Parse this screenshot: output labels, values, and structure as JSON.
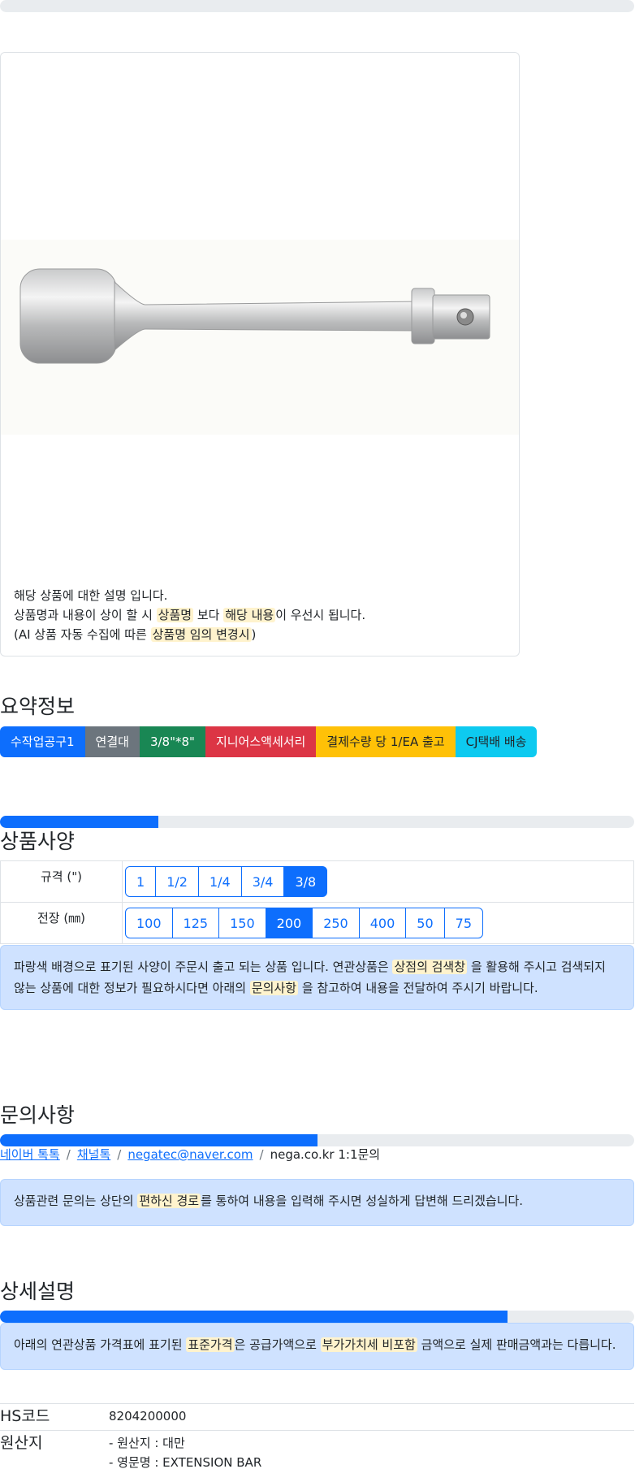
{
  "product": {
    "desc_line1": "해당 상품에 대한 설명 입니다.",
    "desc_line2_a": "상품명과 내용이 상이 할 시",
    "desc_line2_mark1": "상품명",
    "desc_line2_b": "보다",
    "desc_line2_mark2": "해당 내용",
    "desc_line2_c": "이 우선시 됩니다.",
    "desc_line3_a": "(AI 상품 자동 수집에 따른",
    "desc_line3_mark": "상품명 임의 변경시",
    "desc_line3_b": ")"
  },
  "summary": {
    "title": "요약정보",
    "badges": [
      {
        "label": "수작업공구1",
        "color": "#0d6efd"
      },
      {
        "label": "연결대",
        "color": "#6c757d"
      },
      {
        "label": "3/8\"*8\"",
        "color": "#198754"
      },
      {
        "label": "지니어스액세서리",
        "color": "#dc3545"
      },
      {
        "label": "결제수량 당 1/EA 출고",
        "color": "#ffc107"
      },
      {
        "label": "CJ택배 배송",
        "color": "#0dcaf0"
      }
    ]
  },
  "progress": {
    "spec": 25,
    "inquiry": 50,
    "detail": 80
  },
  "spec": {
    "title": "상품사양",
    "rows": [
      {
        "label": "규격 (\")",
        "options": [
          "1",
          "1/2",
          "1/4",
          "3/4",
          "3/8"
        ],
        "selected": "3/8"
      },
      {
        "label": "전장 (㎜)",
        "options": [
          "100",
          "125",
          "150",
          "200",
          "250",
          "400",
          "50",
          "75"
        ],
        "selected": "200"
      }
    ],
    "notice_a": "파랑색 배경으로 표기된 사양이 주문시 출고 되는 상품 입니다. 연관상품은",
    "notice_mark1": "상점의 검색창",
    "notice_b": "을 활용해 주시고 검색되지 않는 상품에 대한 정보가 필요하시다면 아래의",
    "notice_mark2": "문의사항",
    "notice_c": "을 참고하여 내용을 전달하여 주시기 바랍니다."
  },
  "inquiry": {
    "title": "문의사항",
    "links": [
      "네이버 톡톡",
      "채널톡",
      "negatec@naver.com"
    ],
    "plain": "nega.co.kr 1:1문의",
    "sep": "/",
    "notice_a": "상품관련 문의는 상단의",
    "notice_mark": "편하신 경로",
    "notice_b": "를 통하여 내용을 입력해 주시면 성실하게 답변해 드리겠습니다."
  },
  "detail": {
    "title": "상세설명",
    "notice_a": "아래의 연관상품 가격표에 표기된",
    "notice_mark1": "표준가격",
    "notice_b": "은 공급가액으로",
    "notice_mark2": "부가가치세 비포함",
    "notice_c": "금액으로 실제 판매금액과는 다릅니다.",
    "hs_label": "HS코드",
    "hs_value": "8204200000",
    "origin_label": "원산지",
    "origin_line1": "- 원산지 : 대만",
    "origin_line2": "- 영문명 : EXTENSION BAR"
  }
}
